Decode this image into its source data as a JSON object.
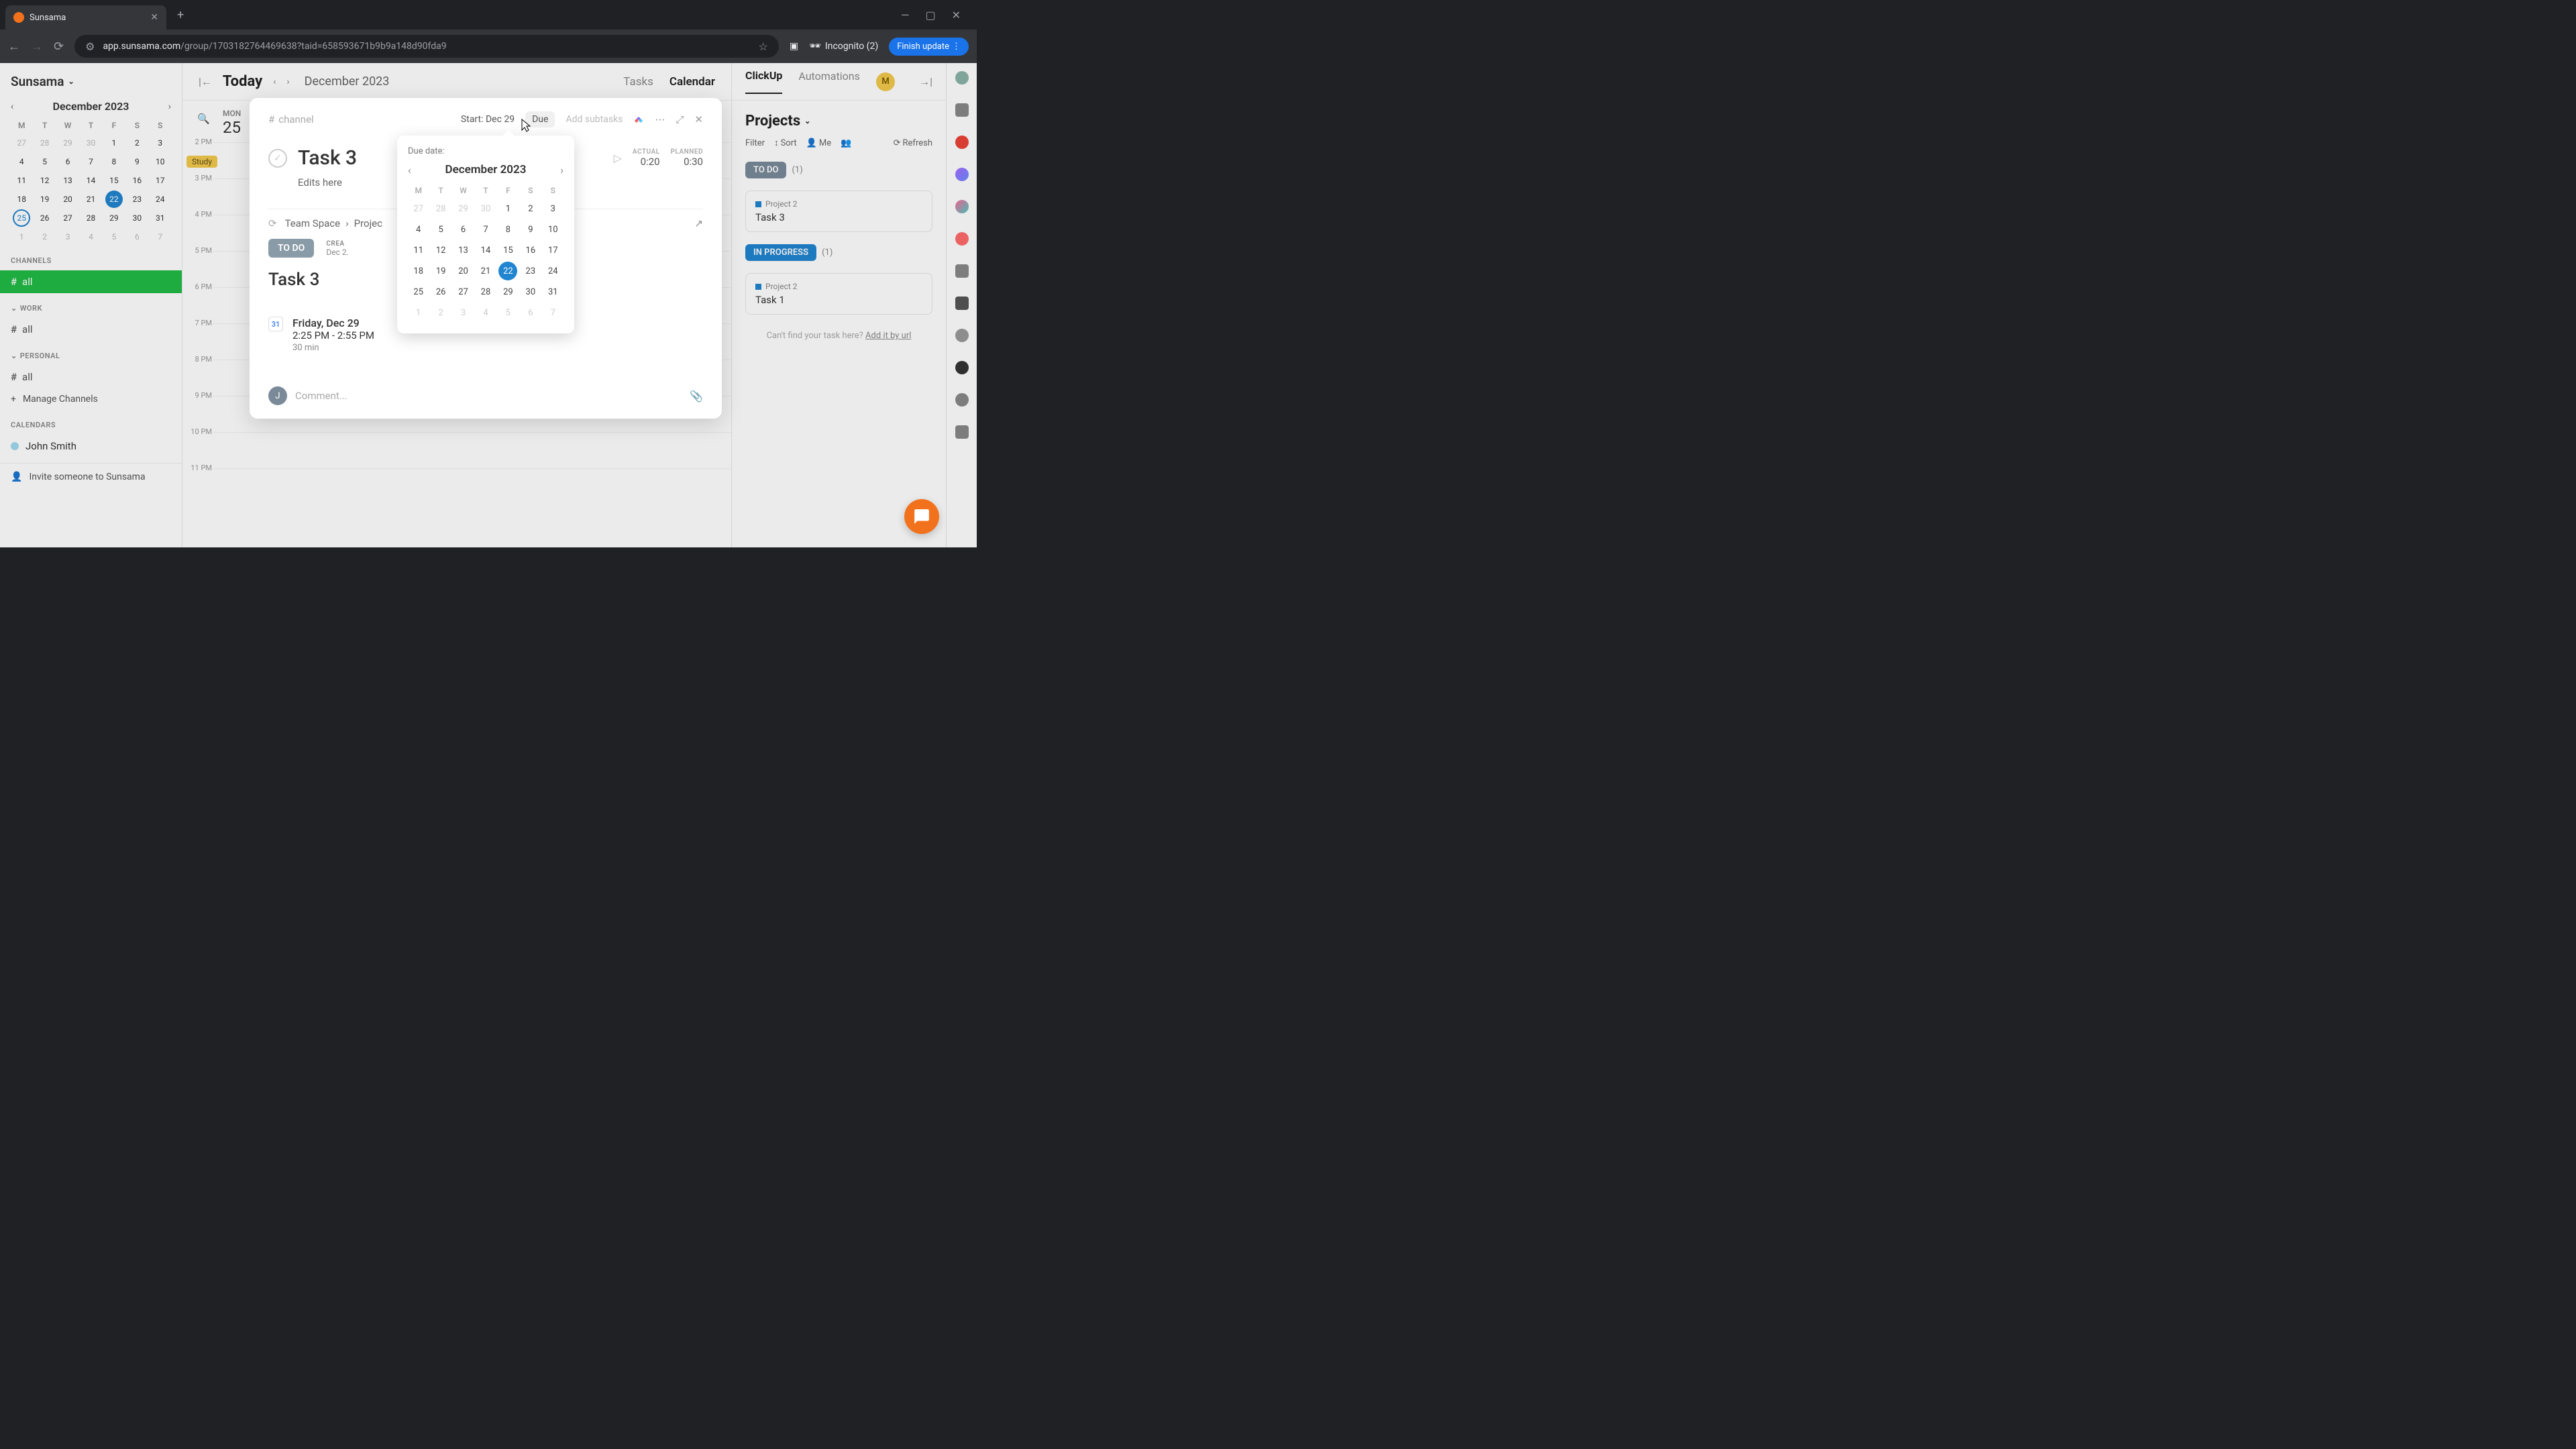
{
  "browser": {
    "tab_title": "Sunsama",
    "url_domain": "app.sunsama.com",
    "url_path": "/group/1703182764469638?taid=658593671b9b9a148d90fda9",
    "incognito": "Incognito (2)",
    "finish_update": "Finish update"
  },
  "workspace": "Sunsama",
  "mini_cal": {
    "month": "December 2023",
    "dow": [
      "M",
      "T",
      "W",
      "T",
      "F",
      "S",
      "S"
    ],
    "prev_trail": [
      "27",
      "28",
      "29",
      "30"
    ],
    "days": [
      "1",
      "2",
      "3",
      "4",
      "5",
      "6",
      "7",
      "8",
      "9",
      "10",
      "11",
      "12",
      "13",
      "14",
      "15",
      "16",
      "17",
      "18",
      "19",
      "20",
      "21",
      "22",
      "23",
      "24",
      "25",
      "26",
      "27",
      "28",
      "29",
      "30",
      "31"
    ],
    "next_trail": [
      "1",
      "2",
      "3",
      "4",
      "5",
      "6",
      "7"
    ],
    "today": "22",
    "selected": "25"
  },
  "sidebar": {
    "channels_header": "CHANNELS",
    "channel_all": "all",
    "work_header": "WORK",
    "work_all": "all",
    "personal_header": "PERSONAL",
    "personal_all": "all",
    "manage": "Manage Channels",
    "calendars_header": "CALENDARS",
    "cal_name": "John Smith",
    "invite": "Invite someone to Sunsama"
  },
  "center": {
    "today": "Today",
    "month": "December 2023",
    "tasks_tab": "Tasks",
    "calendar_tab": "Calendar",
    "day_dow": "MON",
    "day_num": "25",
    "hours": [
      "2 PM",
      "3 PM",
      "4 PM",
      "5 PM",
      "6 PM",
      "7 PM",
      "8 PM",
      "9 PM",
      "10 PM",
      "11 PM"
    ],
    "event_chip": "Study"
  },
  "right": {
    "clickup": "ClickUp",
    "automations": "Automations",
    "avatar": "M",
    "projects": "Projects",
    "filter": "Filter",
    "sort": "Sort",
    "me": "Me",
    "refresh": "Refresh",
    "todo_status": "TO DO",
    "todo_count": "(1)",
    "todo_project": "Project 2",
    "todo_task": "Task 3",
    "progress_status": "IN PROGRESS",
    "progress_count": "(1)",
    "progress_project": "Project 2",
    "progress_task": "Task 1",
    "cant_find": "Can't find your task here?",
    "add_url": "Add it by url"
  },
  "modal": {
    "channel_placeholder": "channel",
    "start": "Start: Dec 29",
    "due": "Due",
    "add_subtasks": "Add subtasks",
    "title": "Task 3",
    "actual_label": "ACTUAL",
    "actual_val": "0:20",
    "planned_label": "PLANNED",
    "planned_val": "0:30",
    "desc": "Edits here",
    "breadcrumb1": "Team Space",
    "breadcrumb2": "Projec",
    "status": "TO DO",
    "created_label": "CREA",
    "created_val": "Dec 2.",
    "clickup_title": "Task 3",
    "event_date": "Friday, Dec 29",
    "event_time": "2:25 PM - 2:55 PM",
    "event_dur": "30 min",
    "comment_avatar": "J",
    "comment_placeholder": "Comment..."
  },
  "picker": {
    "label": "Due date:",
    "month": "December 2023",
    "dow": [
      "M",
      "T",
      "W",
      "T",
      "F",
      "S",
      "S"
    ],
    "prev": [
      "27",
      "28",
      "29",
      "30"
    ],
    "days": [
      "1",
      "2",
      "3",
      "4",
      "5",
      "6",
      "7",
      "8",
      "9",
      "10",
      "11",
      "12",
      "13",
      "14",
      "15",
      "16",
      "17",
      "18",
      "19",
      "20",
      "21",
      "22",
      "23",
      "24",
      "25",
      "26",
      "27",
      "28",
      "29",
      "30",
      "31"
    ],
    "next": [
      "1",
      "2",
      "3",
      "4",
      "5",
      "6",
      "7"
    ],
    "selected": "22"
  }
}
